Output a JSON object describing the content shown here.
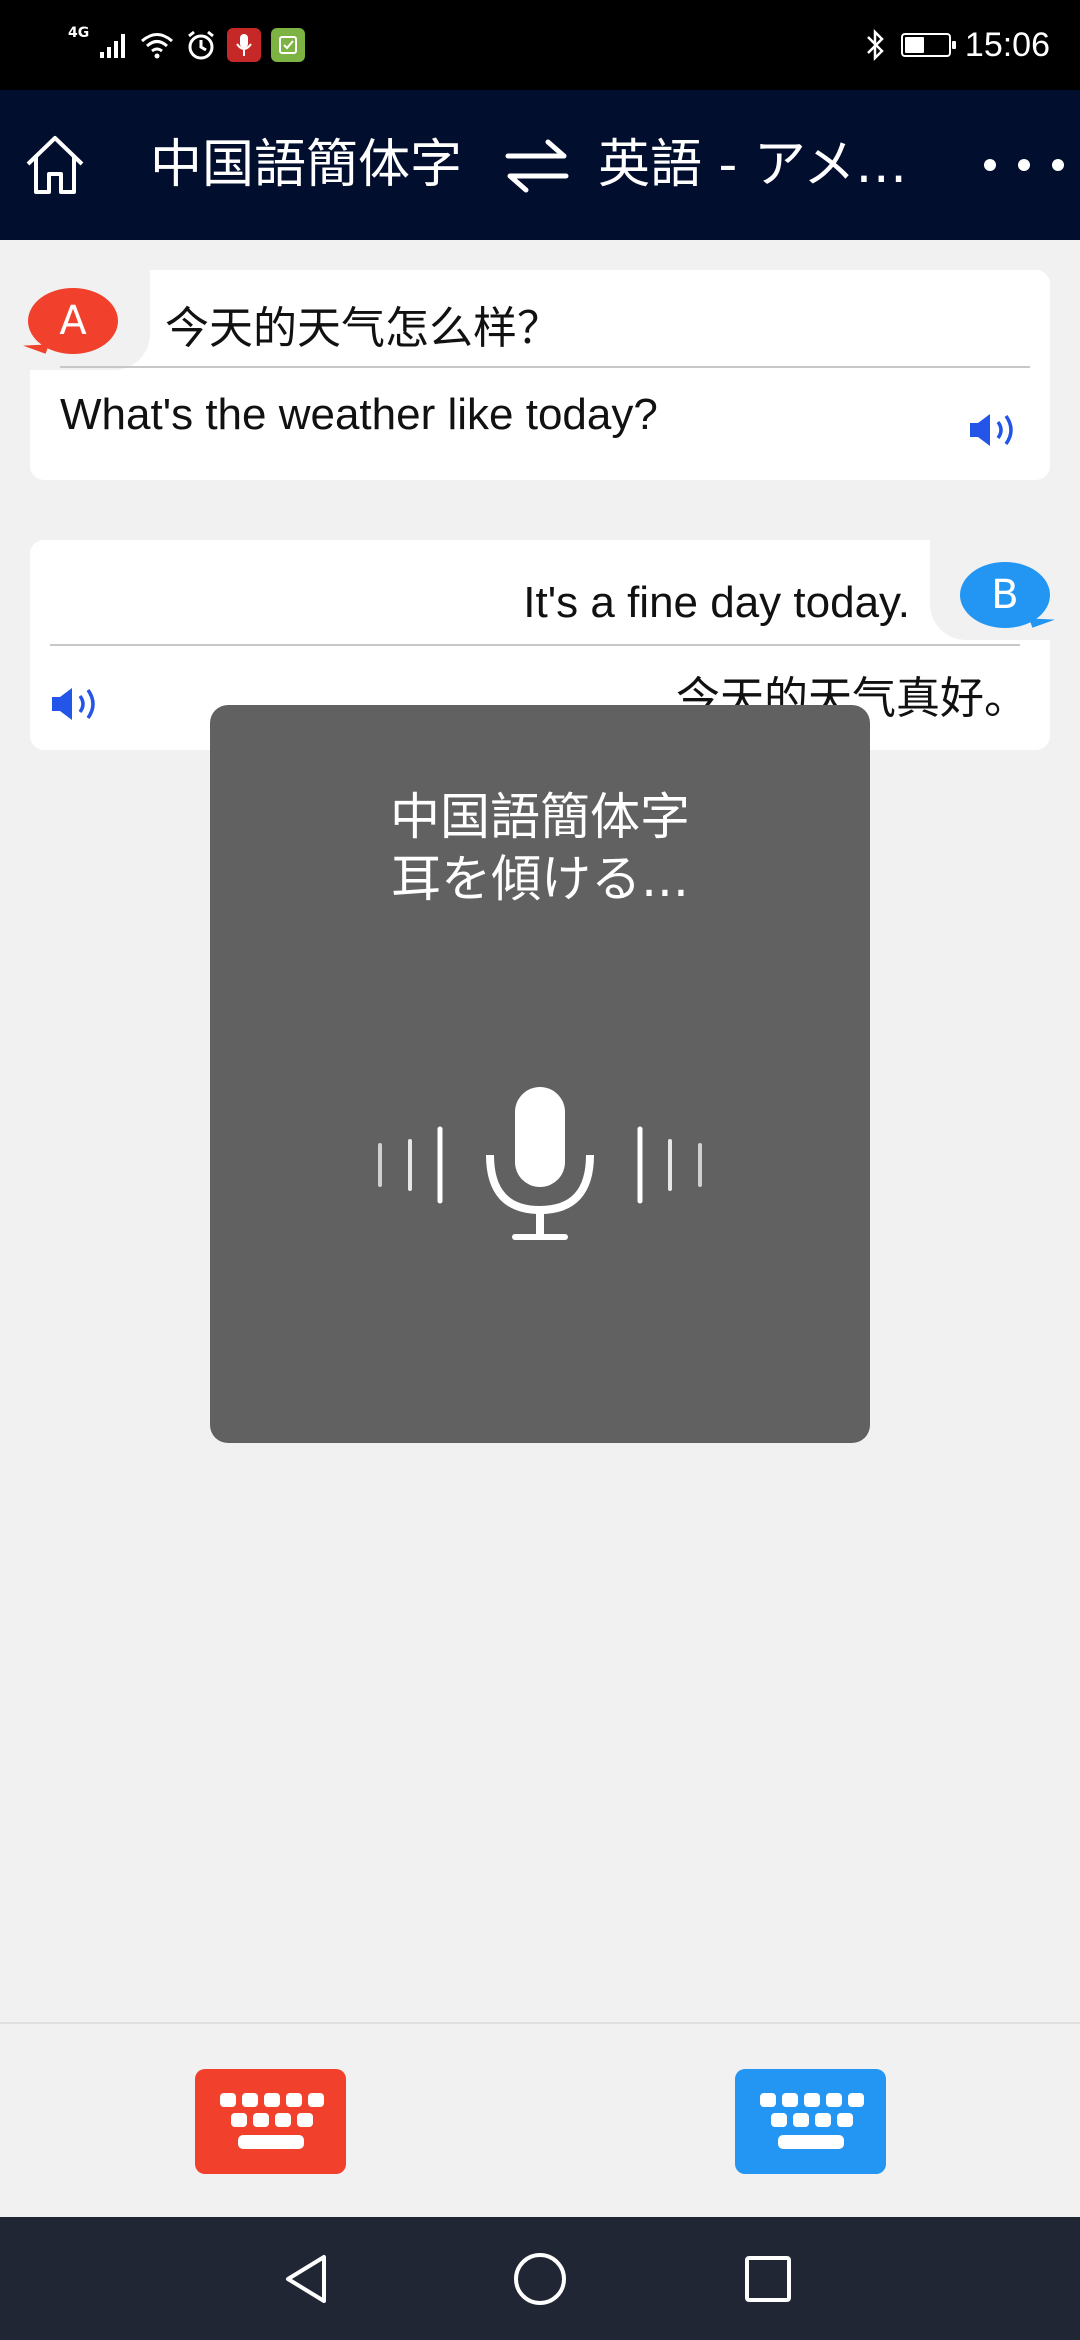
{
  "status_bar": {
    "network": "4G",
    "time": "15:06",
    "battery_level": 0.45,
    "icons": [
      "signal-icon",
      "wifi-icon",
      "alarm-icon",
      "mic-app-icon",
      "tasks-app-icon",
      "bluetooth-icon",
      "battery-icon"
    ]
  },
  "header": {
    "source_language": "中国語簡体字",
    "target_language": "英語 - アメリカ",
    "icons": [
      "home-icon",
      "swap-icon",
      "more-icon"
    ]
  },
  "conversation": [
    {
      "speaker": "A",
      "source_text": "今天的天气怎么样？",
      "translation": "What's the weather like today?",
      "color": "#f1412c"
    },
    {
      "speaker": "B",
      "source_text": "It's a fine day today.",
      "translation": "今天的天气真好。",
      "color": "#2396f3"
    }
  ],
  "listening": {
    "language": "中国語簡体字",
    "status": "耳を傾ける..."
  },
  "colors": {
    "header_bg": "#020e2e",
    "speaker_a": "#f1412c",
    "speaker_b": "#2396f3",
    "speaker_icon": "#2356e8",
    "overlay_bg": "#616161"
  }
}
